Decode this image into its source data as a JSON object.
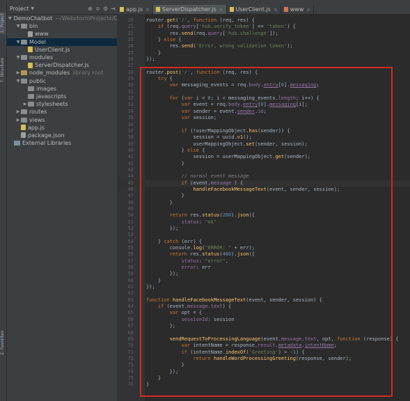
{
  "project_panel": {
    "title": "Project",
    "tree": [
      {
        "label": "DemoChatbot",
        "note": "~/WebstormProjects/Dem",
        "type": "folder",
        "depth": 0,
        "expanded": true
      },
      {
        "label": "bin",
        "type": "folder",
        "depth": 1,
        "expanded": true
      },
      {
        "label": "www",
        "type": "file",
        "depth": 2
      },
      {
        "label": "Model",
        "type": "folder",
        "depth": 1,
        "expanded": true
      },
      {
        "label": "UserClient.js",
        "type": "js",
        "depth": 2
      },
      {
        "label": "modules",
        "type": "folder",
        "depth": 1,
        "expanded": true
      },
      {
        "label": "ServerDispatcher.js",
        "type": "js",
        "depth": 2
      },
      {
        "label": "node_modules",
        "note": "library root",
        "type": "folder",
        "depth": 1,
        "expanded": false
      },
      {
        "label": "public",
        "type": "folder",
        "depth": 1,
        "expanded": true
      },
      {
        "label": "images",
        "type": "folder",
        "depth": 2
      },
      {
        "label": "javascripts",
        "type": "folder",
        "depth": 2
      },
      {
        "label": "stylesheets",
        "type": "folder",
        "depth": 2,
        "expanded": false
      },
      {
        "label": "routes",
        "type": "folder",
        "depth": 1,
        "expanded": false
      },
      {
        "label": "views",
        "type": "folder",
        "depth": 1,
        "expanded": false
      },
      {
        "label": "app.js",
        "type": "js",
        "depth": 1
      },
      {
        "label": "package.json",
        "type": "json",
        "depth": 1
      },
      {
        "label": "External Libraries",
        "type": "lib",
        "depth": 0
      }
    ]
  },
  "tabs": [
    {
      "label": "app.js",
      "type": "js",
      "active": false
    },
    {
      "label": "ServerDispatcher.js",
      "type": "js",
      "active": true
    },
    {
      "label": "UserClient.js",
      "type": "js",
      "active": false
    },
    {
      "label": "www",
      "type": "html",
      "active": false
    }
  ],
  "editor": {
    "highlight_color": "#d42a1f",
    "lines": [
      {
        "n": 20,
        "html": "router.<span class=\"f\">get</span>(<span class=\"s\">'/'</span>, <span class=\"k\">function</span> (req, res) {"
      },
      {
        "n": 21,
        "html": "    <span class=\"k\">if</span> (req.<span class=\"p\">query</span>[<span class=\"s\">'hub.verify_token'</span>] == <span class=\"s\">'token'</span>) {"
      },
      {
        "n": 22,
        "html": "        res.<span class=\"f\">send</span>(req.<span class=\"p\">query</span>[<span class=\"s\">'hub.challenge'</span>]);"
      },
      {
        "n": 23,
        "html": "    } <span class=\"k\">else</span> {"
      },
      {
        "n": 24,
        "html": "        res.<span class=\"f\">send</span>(<span class=\"s\">'Error, wrong validation token'</span>);"
      },
      {
        "n": 25,
        "html": "    }"
      },
      {
        "n": 26,
        "html": "});"
      },
      {
        "n": 27,
        "html": ""
      },
      {
        "n": 28,
        "html": "router.<span class=\"f\">post</span>(<span class=\"s\">'/'</span>, <span class=\"k\">function</span> (req, res) {"
      },
      {
        "n": 29,
        "html": "    <span class=\"k\">try</span> {"
      },
      {
        "n": 30,
        "html": "        <span class=\"k\">var</span> messaging_events = req.<span class=\"p\">body</span>.<span class=\"p u\">entry</span>[<span class=\"n\">0</span>].<span class=\"p u\">messaging</span>;"
      },
      {
        "n": 31,
        "html": ""
      },
      {
        "n": 32,
        "html": "        <span class=\"k\">for</span> (<span class=\"k\">var</span> i = <span class=\"n\">0</span>; i &lt; messaging_events.<span class=\"p\">length</span>; i++) {"
      },
      {
        "n": 33,
        "html": "            <span class=\"k\">var</span> event = req.<span class=\"p\">body</span>.<span class=\"p u\">entry</span>[<span class=\"n\">0</span>].<span class=\"p u\">messaging</span>[i];"
      },
      {
        "n": 34,
        "html": "            <span class=\"k\">var</span> sender = event.<span class=\"p u\">sender</span>.<span class=\"p\">id</span>;"
      },
      {
        "n": 35,
        "html": "            <span class=\"k\">var</span> session;"
      },
      {
        "n": 36,
        "html": ""
      },
      {
        "n": 37,
        "html": "            <span class=\"k\">if</span> (!userMappingObject.<span class=\"f\">has</span>(sender)) {"
      },
      {
        "n": 38,
        "html": "                session = uuid.<span class=\"f\">v1</span>();"
      },
      {
        "n": 39,
        "html": "                userMappingObject.<span class=\"f\">set</span>(sender, session);"
      },
      {
        "n": 40,
        "html": "            } <span class=\"k\">else</span> {"
      },
      {
        "n": 41,
        "html": "                session = userMappingObject.<span class=\"f\">get</span>(sender);"
      },
      {
        "n": 42,
        "html": "            }"
      },
      {
        "n": 43,
        "html": ""
      },
      {
        "n": 44,
        "html": "            <span class=\"c\">// normal event message</span>"
      },
      {
        "n": 45,
        "html": "            <span class=\"k\">if</span> (event.<span class=\"p\">message</span> ) {"
      },
      {
        "n": 46,
        "html": "                <span class=\"f\">handleFacebookMessageText</span>(event, sender, session);"
      },
      {
        "n": 47,
        "html": "            }"
      },
      {
        "n": 48,
        "html": "        }"
      },
      {
        "n": 49,
        "html": ""
      },
      {
        "n": 50,
        "html": "        <span class=\"k\">return</span> res.<span class=\"f\">status</span>(<span class=\"n\">200</span>).<span class=\"f\">json</span>({"
      },
      {
        "n": 51,
        "html": "            <span class=\"p\">status</span>: <span class=\"s\">\"ok\"</span>"
      },
      {
        "n": 52,
        "html": "        });"
      },
      {
        "n": 53,
        "html": ""
      },
      {
        "n": 54,
        "html": "    } <span class=\"k\">catch</span> (err) {"
      },
      {
        "n": 55,
        "html": "        console.<span class=\"f\">log</span>(<span class=\"s\">\"ERROR: \"</span> + err);"
      },
      {
        "n": 56,
        "html": "        <span class=\"k\">return</span> res.<span class=\"f\">status</span>(<span class=\"n\">400</span>).<span class=\"f\">json</span>({"
      },
      {
        "n": 57,
        "html": "            <span class=\"p\">status</span>: <span class=\"s\">\"error\"</span>,"
      },
      {
        "n": 58,
        "html": "            <span class=\"p\">error</span>: err"
      },
      {
        "n": 59,
        "html": "        });"
      },
      {
        "n": 60,
        "html": "    }"
      },
      {
        "n": 61,
        "html": "});"
      },
      {
        "n": 62,
        "html": ""
      },
      {
        "n": 63,
        "html": "<span class=\"k\">function</span> <span class=\"f\">handleFacebookMessageText</span>(event, sender, session) {"
      },
      {
        "n": 64,
        "html": "    <span class=\"k\">if</span> (event.<span class=\"p\">message</span>.<span class=\"p\">text</span>) {"
      },
      {
        "n": 65,
        "html": "        <span class=\"k\">var</span> opt = {"
      },
      {
        "n": 66,
        "html": "            <span class=\"p\">sessionId</span>: session"
      },
      {
        "n": 67,
        "html": "        };"
      },
      {
        "n": 68,
        "html": ""
      },
      {
        "n": 69,
        "html": "        <span class=\"f\">sendRequestToProcessingLanguage</span>(event.<span class=\"p\">message</span>.<span class=\"p\">text</span>, opt, <span class=\"k\">function</span> (response) {"
      },
      {
        "n": 70,
        "html": "            <span class=\"k\">var</span> intentName = response.<span class=\"p\">result</span>.<span class=\"p u\">metadata</span>.<span class=\"p u\">intentName</span>;"
      },
      {
        "n": 71,
        "html": "            <span class=\"k\">if</span> (intentName.<span class=\"f\">indexOf</span>(<span class=\"s\">'Greeting'</span>) &gt; -<span class=\"n\">1</span>) {"
      },
      {
        "n": 72,
        "html": "                <span class=\"k\">return</span> <span class=\"f\">handleWordProcessingGreeting</span>(response, sender);"
      },
      {
        "n": 73,
        "html": "            }"
      },
      {
        "n": 74,
        "html": "        });"
      },
      {
        "n": 75,
        "html": "    }"
      },
      {
        "n": 76,
        "html": "}"
      }
    ]
  }
}
